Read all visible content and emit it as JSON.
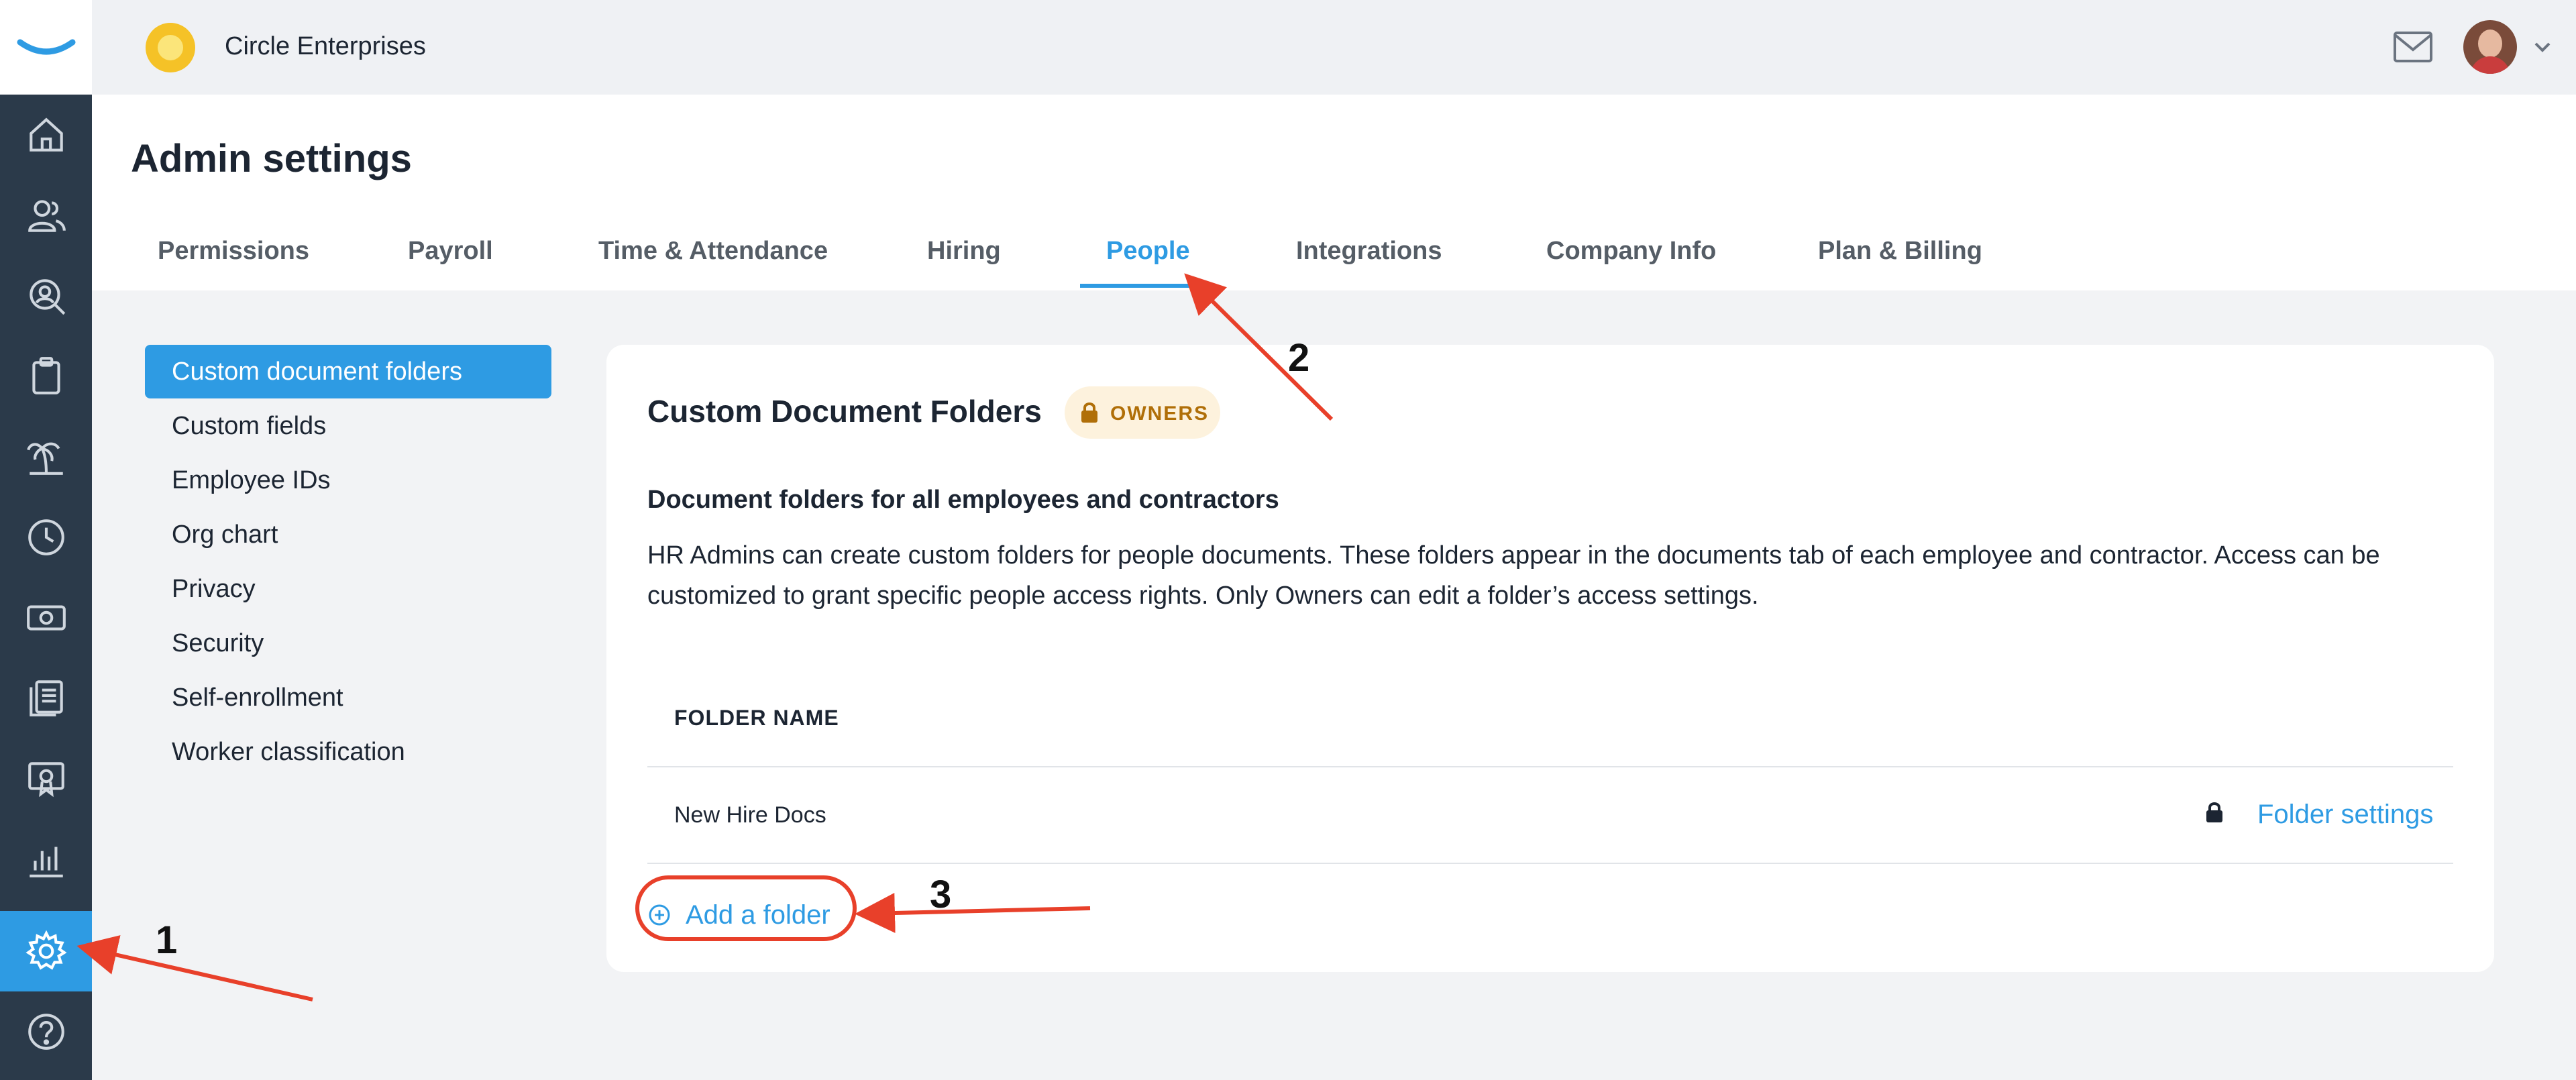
{
  "topbar": {
    "company_name": "Circle Enterprises"
  },
  "header": {
    "title": "Admin settings",
    "tabs": [
      {
        "label": "Permissions"
      },
      {
        "label": "Payroll"
      },
      {
        "label": "Time & Attendance"
      },
      {
        "label": "Hiring"
      },
      {
        "label": "People"
      },
      {
        "label": "Integrations"
      },
      {
        "label": "Company Info"
      },
      {
        "label": "Plan & Billing"
      }
    ],
    "active_tab": "People"
  },
  "sidebar_rail": {
    "icons": [
      "home-icon",
      "people-icon",
      "search-person-icon",
      "clipboard-icon",
      "palm-tree-icon",
      "clock-icon",
      "money-icon",
      "documents-icon",
      "certificate-icon",
      "bar-chart-icon",
      "gear-icon",
      "help-icon"
    ],
    "active": "gear-icon"
  },
  "subnav": {
    "items": [
      {
        "label": "Custom document folders"
      },
      {
        "label": "Custom fields"
      },
      {
        "label": "Employee IDs"
      },
      {
        "label": "Org chart"
      },
      {
        "label": "Privacy"
      },
      {
        "label": "Security"
      },
      {
        "label": "Self-enrollment"
      },
      {
        "label": "Worker classification"
      }
    ],
    "active": "Custom document folders"
  },
  "card": {
    "title": "Custom Document Folders",
    "badge": "OWNERS",
    "section_heading": "Document folders for all employees and contractors",
    "description": "HR Admins can create custom folders for people documents. These folders appear in the documents tab of each employee and contractor. Access can be customized to grant specific people access rights. Only Owners can edit a folder’s access settings.",
    "table": {
      "column_header": "FOLDER NAME",
      "rows": [
        {
          "name": "New Hire Docs",
          "action": "Folder settings"
        }
      ]
    },
    "add_folder_label": "Add a folder"
  },
  "annotations": {
    "step1": "1",
    "step2": "2",
    "step3": "3"
  },
  "colors": {
    "accent": "#2e9be3",
    "rail": "#2b3a4a",
    "badge_bg": "#fdf2dd",
    "badge_text": "#b06f08",
    "annotation": "#e8402a"
  }
}
